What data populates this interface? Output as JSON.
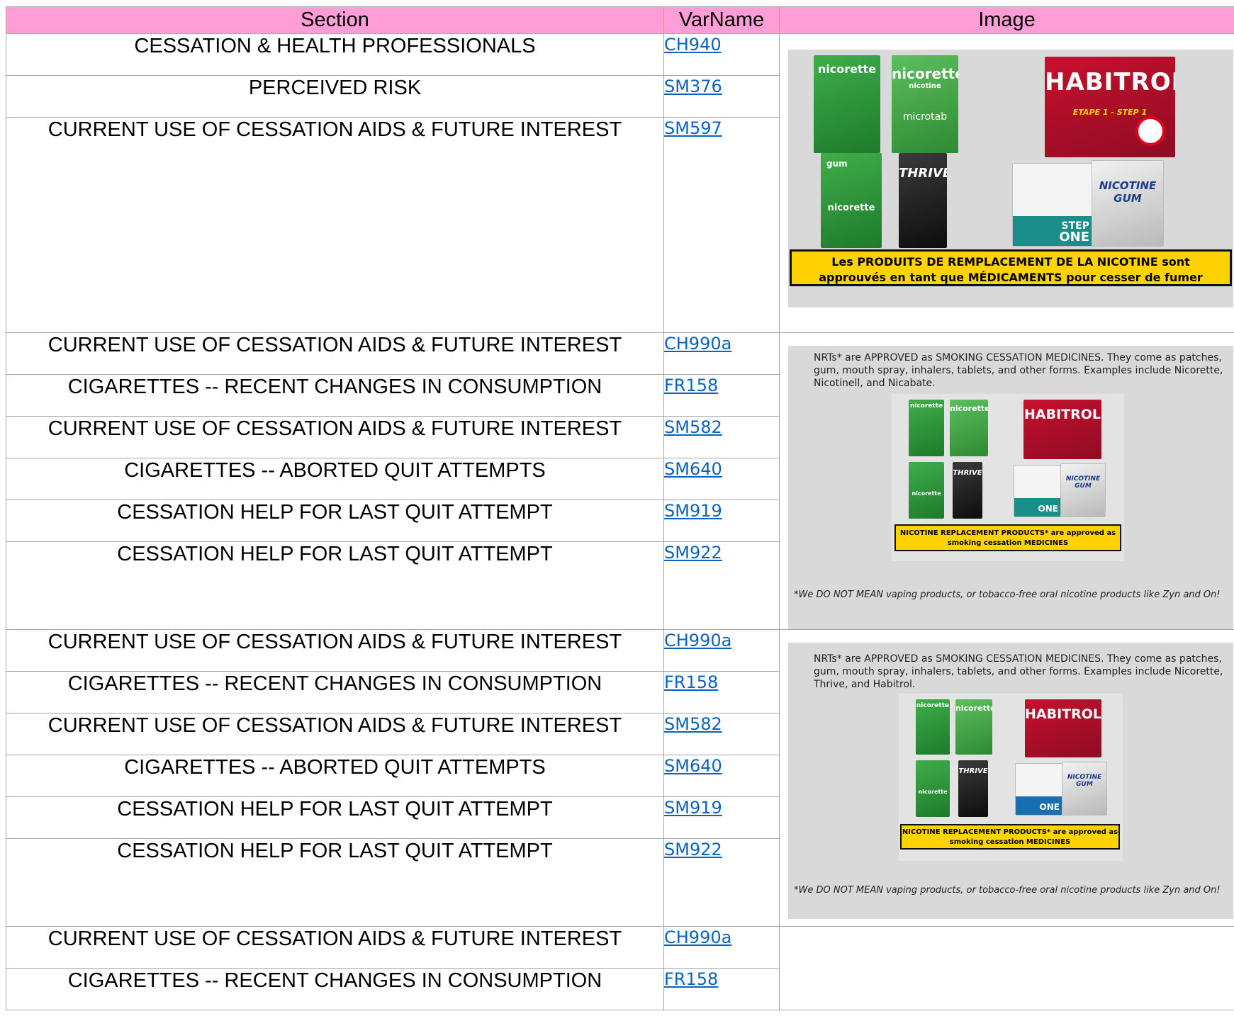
{
  "headers": {
    "section": "Section",
    "varname": "VarName",
    "image": "Image"
  },
  "rows": [
    {
      "section": "CESSATION & HEALTH PROFESSIONALS",
      "var": "CH940"
    },
    {
      "section": "PERCEIVED RISK",
      "var": "SM376"
    },
    {
      "section": "CURRENT USE OF CESSATION AIDS & FUTURE INTEREST",
      "var": "SM597"
    },
    {
      "section": "CURRENT USE OF CESSATION AIDS & FUTURE INTEREST",
      "var": "CH990a"
    },
    {
      "section": "CIGARETTES -- RECENT CHANGES IN CONSUMPTION",
      "var": "FR158"
    },
    {
      "section": "CURRENT USE OF CESSATION AIDS & FUTURE INTEREST",
      "var": "SM582"
    },
    {
      "section": "CIGARETTES -- ABORTED QUIT ATTEMPTS",
      "var": "SM640"
    },
    {
      "section": "CESSATION HELP FOR LAST QUIT ATTEMPT",
      "var": "SM919"
    },
    {
      "section": "CESSATION HELP FOR LAST QUIT ATTEMPT",
      "var": "SM922"
    },
    {
      "section": "CURRENT USE OF CESSATION AIDS & FUTURE INTEREST",
      "var": "CH990a"
    },
    {
      "section": "CIGARETTES -- RECENT CHANGES IN CONSUMPTION",
      "var": "FR158"
    },
    {
      "section": "CURRENT USE OF CESSATION AIDS & FUTURE INTEREST",
      "var": "SM582"
    },
    {
      "section": "CIGARETTES -- ABORTED QUIT ATTEMPTS",
      "var": "SM640"
    },
    {
      "section": "CESSATION HELP FOR LAST QUIT ATTEMPT",
      "var": "SM919"
    },
    {
      "section": "CESSATION HELP FOR LAST QUIT ATTEMPT",
      "var": "SM922"
    },
    {
      "section": "CURRENT USE OF CESSATION AIDS & FUTURE INTEREST",
      "var": "CH990a"
    },
    {
      "section": "CIGARETTES -- RECENT CHANGES IN CONSUMPTION",
      "var": "FR158"
    }
  ],
  "products": {
    "nicorette": "nicorette",
    "nicorette_sub": "nicotine",
    "microtab": "microtab",
    "habitrol": "HABITROL",
    "etape": "ETAPE 1 - STEP 1",
    "gum": "gum",
    "thrive": "THRIVE",
    "step": "STEP",
    "one": "ONE",
    "nicotine_gum": "NICOTINE GUM"
  },
  "image1": {
    "banner_line1": "Les PRODUITS DE REMPLACEMENT DE LA NICOTINE sont",
    "banner_line2": "approuvés en tant que MÉDICAMENTS pour cesser de fumer"
  },
  "image2": {
    "intro": "NRTs* are APPROVED as SMOKING CESSATION MEDICINES. They come as patches, gum, mouth spray, inhalers, tablets, and other forms. Examples include Nicorette, Nicotinell, and Nicabate.",
    "banner_line1": "NICOTINE REPLACEMENT PRODUCTS* are approved as",
    "banner_line2": "smoking cessation MEDICINES",
    "footnote": "*We DO NOT MEAN vaping products, or tobacco-free oral nicotine products like Zyn and On!"
  },
  "image3": {
    "intro": "NRTs* are APPROVED as SMOKING CESSATION MEDICINES. They come as patches, gum, mouth spray, inhalers, tablets, and other forms. Examples include Nicorette, Thrive, and Habitrol.",
    "banner_line1": "NICOTINE REPLACEMENT PRODUCTS* are approved as",
    "banner_line2": "smoking cessation MEDICINES",
    "footnote": "*We DO NOT MEAN vaping products, or tobacco-free oral nicotine products like Zyn and On!"
  },
  "colors": {
    "header_bg": "#ff9dd6",
    "link": "#0b63c1",
    "banner_yellow": "#ffd200",
    "panel_gray": "#d9d9d9"
  }
}
